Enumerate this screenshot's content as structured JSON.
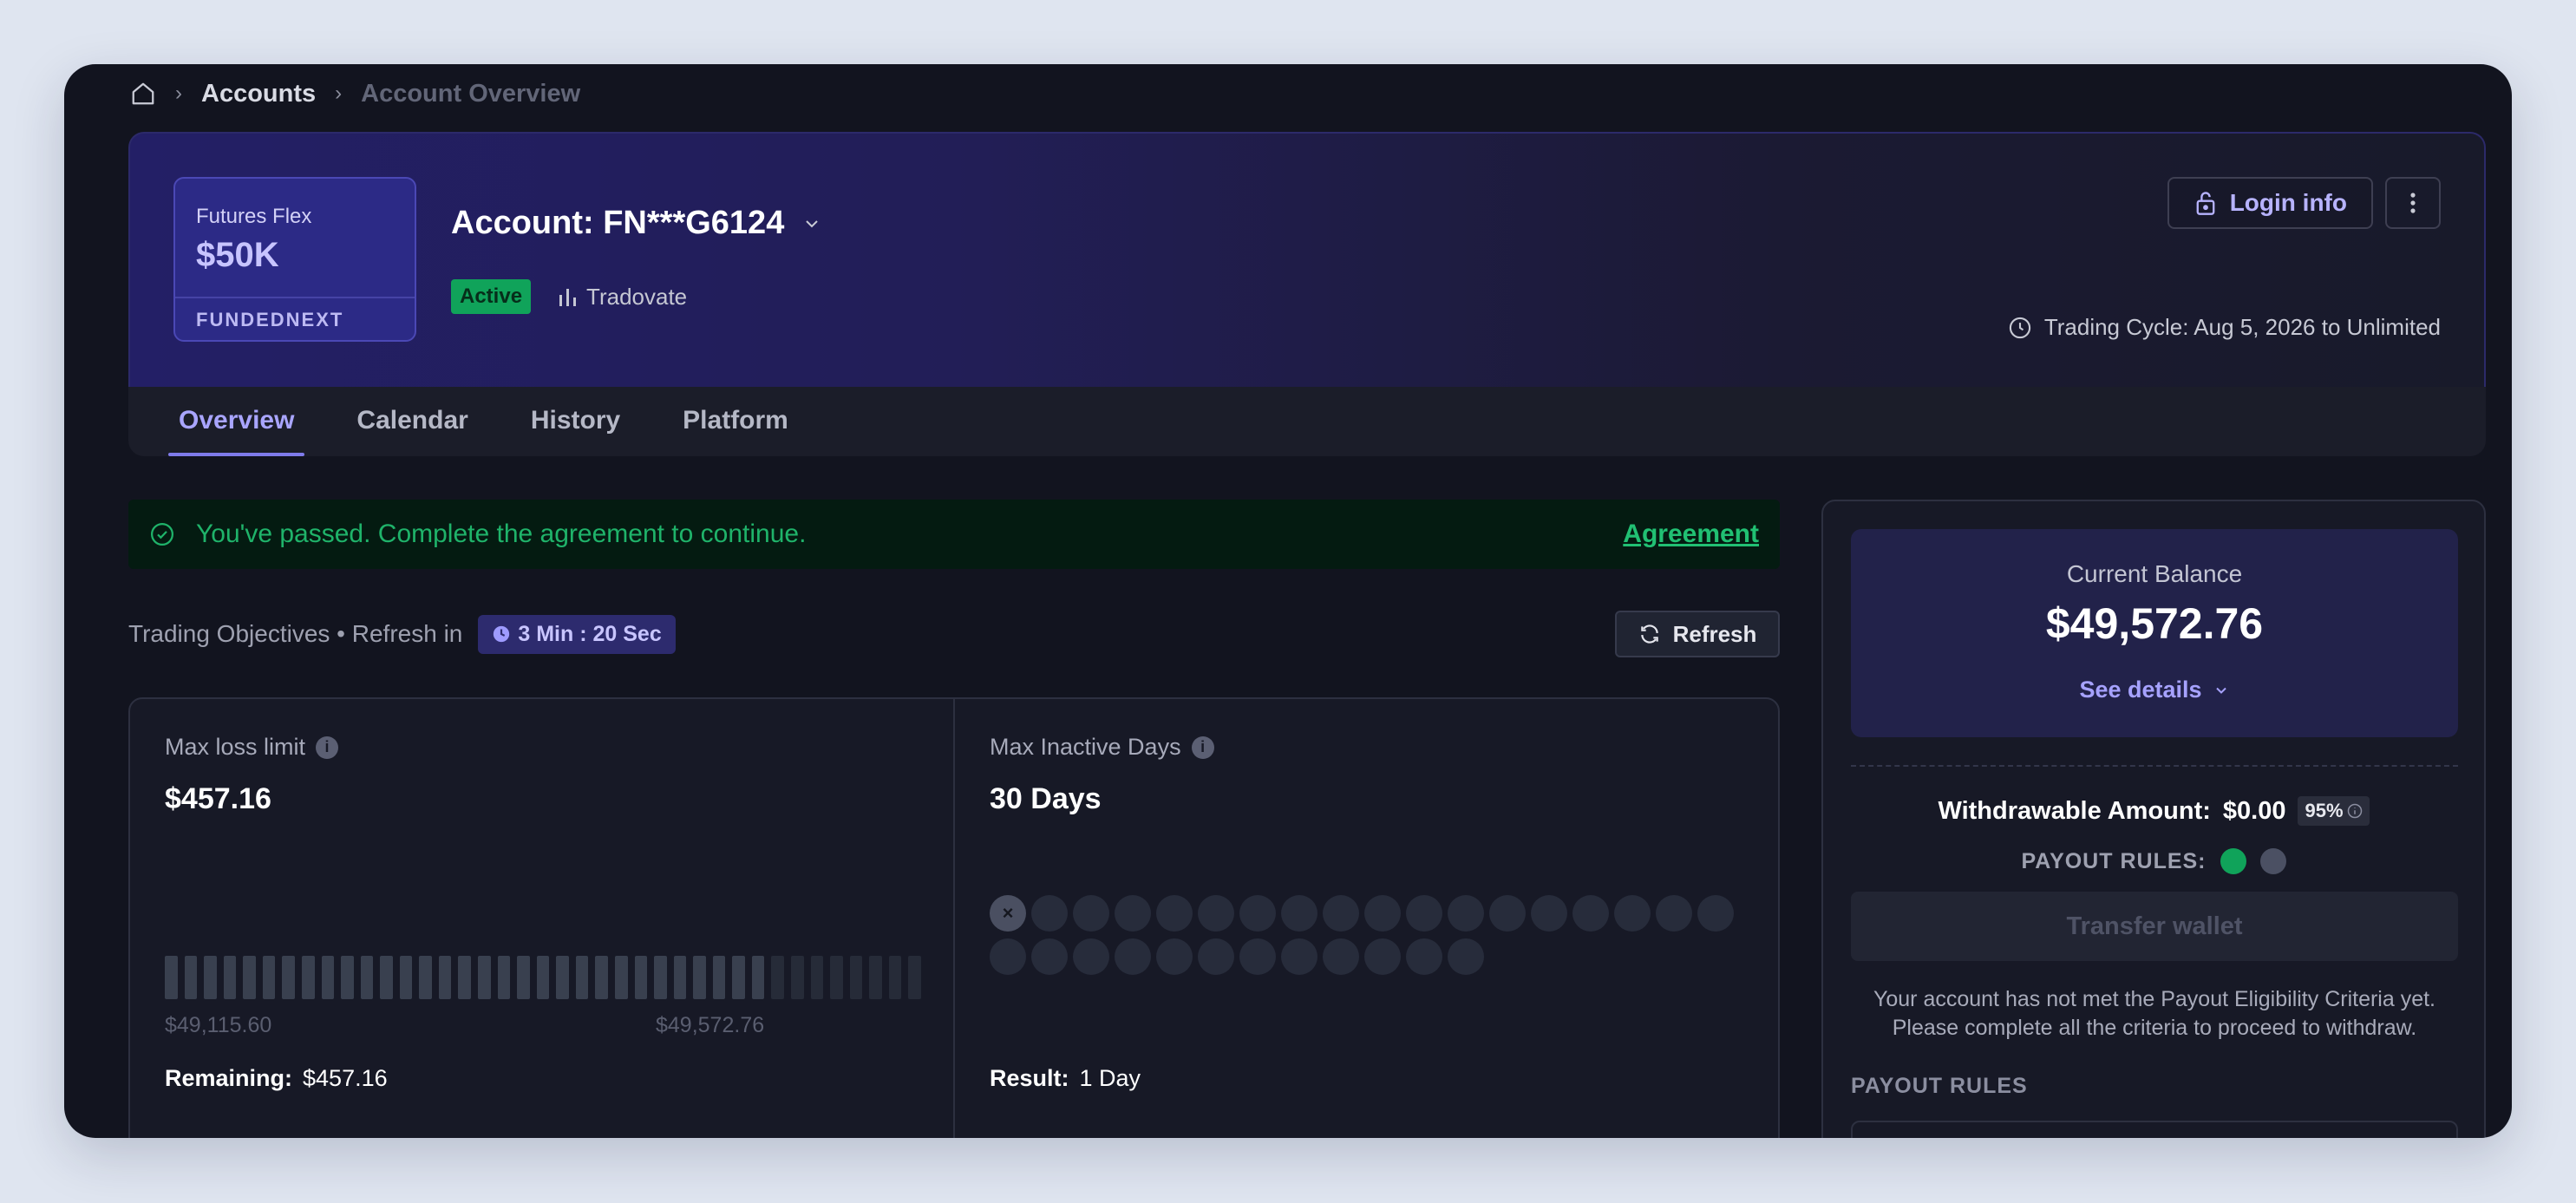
{
  "breadcrumb": {
    "home_icon": "home-icon",
    "items": [
      "Accounts",
      "Account Overview"
    ]
  },
  "account": {
    "plan": "Futures Flex",
    "amount": "$50K",
    "brand": "FUNDEDNEXT",
    "title": "Account: FN***G6124",
    "status": "Active",
    "platform": "Tradovate",
    "login_label": "Login info",
    "trading_cycle": "Trading Cycle: Aug 5, 2026 to Unlimited"
  },
  "tabs": [
    {
      "label": "Overview",
      "active": true
    },
    {
      "label": "Calendar",
      "active": false
    },
    {
      "label": "History",
      "active": false
    },
    {
      "label": "Platform",
      "active": false
    }
  ],
  "banner": {
    "message": "You've passed. Complete the agreement to continue.",
    "link": "Agreement"
  },
  "objectives": {
    "label": "Trading Objectives • Refresh in",
    "timer": "3 Min : 20 Sec",
    "refresh_label": "Refresh"
  },
  "max_loss": {
    "label": "Max loss limit",
    "value": "$457.16",
    "min_label": "$49,115.60",
    "max_label": "$49,572.76",
    "remaining_label": "Remaining:",
    "remaining_value": "$457.16",
    "filled_bars": 31,
    "total_bars": 39
  },
  "inactive": {
    "label": "Max Inactive Days",
    "value": "30 Days",
    "result_label": "Result:",
    "result_value": "1 Day",
    "days_total": 30,
    "days_marked": 1
  },
  "panel": {
    "balance_label": "Current Balance",
    "balance_value": "$49,572.76",
    "see_details": "See details",
    "withdraw_label": "Withdrawable Amount:",
    "withdraw_value": "$0.00",
    "withdraw_pct": "95%",
    "payout_rules_label": "PAYOUT RULES:",
    "transfer_label": "Transfer wallet",
    "notice": "Your account has not met the Payout Eligibility Criteria yet. Please complete all the criteria to proceed to withdraw.",
    "payout_rules_heading": "PAYOUT RULES"
  },
  "colors": {
    "accent": "#8a86ff",
    "success": "#10a35a",
    "rule_dot_1": "#10a35a",
    "rule_dot_2": "#4b5063"
  }
}
